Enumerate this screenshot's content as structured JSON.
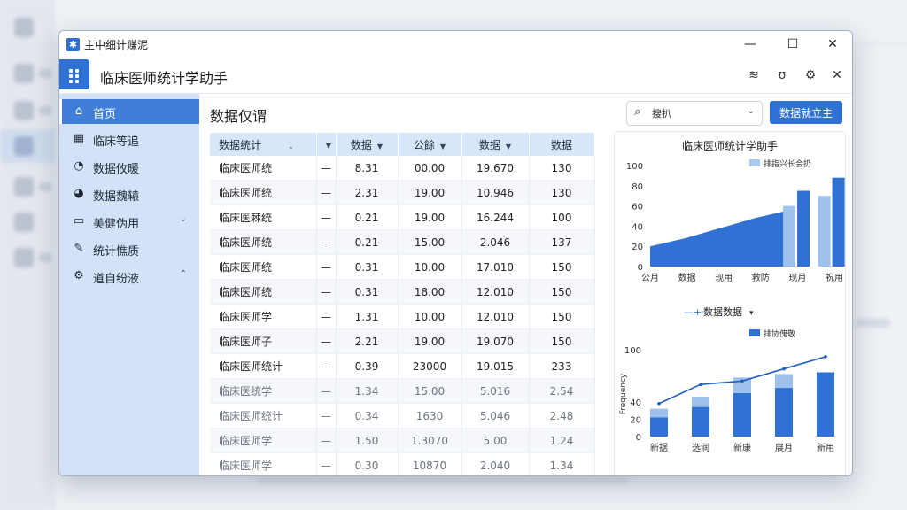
{
  "window": {
    "title": "主中细计赚泥",
    "app_name": "临床医师统计学助手",
    "controls": {
      "minimize": "—",
      "maximize": "☐",
      "close": "✕"
    }
  },
  "sidebar": {
    "items": [
      {
        "label": "首页",
        "icon": "home-icon",
        "active": true
      },
      {
        "label": "临床等追",
        "icon": "grid-icon"
      },
      {
        "label": "数据攸暖",
        "icon": "chart-icon"
      },
      {
        "label": "数据魏辕",
        "icon": "pie-icon"
      },
      {
        "label": "美健伪用",
        "icon": "doc-icon",
        "chevron": "down"
      },
      {
        "label": "统计憔质",
        "icon": "edit-icon"
      },
      {
        "label": "道自纷液",
        "icon": "gear-icon",
        "chevron": "up"
      }
    ]
  },
  "main": {
    "page_title": "数据仅谓",
    "search": {
      "value": "搜扒"
    },
    "primary_button": "数据就立主"
  },
  "table": {
    "headers": [
      "数据统计",
      "",
      "数据",
      "公餘",
      "数据",
      "数据"
    ],
    "rows": [
      [
        "临床医师统",
        "—",
        "8.31",
        "00.00",
        "19.670",
        "130"
      ],
      [
        "临床医师统",
        "—",
        "2.31",
        "19.00",
        "10.946",
        "130"
      ],
      [
        "临床医棘统",
        "—",
        "0.21",
        "19.00",
        "16.244",
        "100"
      ],
      [
        "临床医师统",
        "—",
        "0.21",
        "15.00",
        "2.046",
        "137"
      ],
      [
        "临床医师统",
        "—",
        "0.31",
        "10.00",
        "17.010",
        "150"
      ],
      [
        "临床医师统",
        "—",
        "0.31",
        "18.00",
        "12.010",
        "150"
      ],
      [
        "临床医师学",
        "—",
        "1.31",
        "10.00",
        "12.010",
        "150"
      ],
      [
        "临床医师子",
        "—",
        "2.21",
        "19.00",
        "19.070",
        "150"
      ],
      [
        "临床医师统计",
        "—",
        "0.39",
        "23000",
        "19.015",
        "233"
      ],
      [
        "临床医统学",
        "—",
        "1.34",
        "15.00",
        "5.016",
        "2.54"
      ],
      [
        "临床医师统计",
        "—",
        "0.34",
        "1630",
        "5.046",
        "2.48"
      ],
      [
        "临床医师学",
        "—",
        "1.50",
        "1.3070",
        "5.00",
        "1.24"
      ],
      [
        "临床医师学",
        "—",
        "0.30",
        "10870",
        "2.040",
        "1.34"
      ]
    ]
  },
  "chart_data": [
    {
      "type": "area",
      "title": "临床医师统计学助手",
      "legend": "排指兴长会扔",
      "legend_position": "top-right",
      "categories": [
        "公月",
        "数据",
        "现用",
        "救防",
        "现月",
        "祝用"
      ],
      "area_values": [
        20,
        28,
        38,
        48,
        56,
        62
      ],
      "bar_values": [
        null,
        null,
        null,
        null,
        75,
        88
      ],
      "bar_light_values": [
        null,
        null,
        null,
        null,
        60,
        70
      ],
      "ylim": [
        0,
        100
      ],
      "yticks": [
        0,
        20,
        40,
        60,
        80,
        100
      ]
    },
    {
      "type": "bar",
      "title": "数据数据",
      "legend": "排协傀敬",
      "legend_position": "top-right",
      "ylabel": "Frequency",
      "categories": [
        "新据",
        "选润",
        "新康",
        "展月",
        "新用"
      ],
      "series_dark": [
        22,
        34,
        50,
        56,
        74
      ],
      "series_light": [
        32,
        46,
        68,
        72,
        74
      ],
      "line_values": [
        38,
        60,
        64,
        78,
        92
      ],
      "ylim": [
        0,
        100
      ],
      "yticks": [
        0,
        20,
        40,
        100
      ]
    }
  ]
}
